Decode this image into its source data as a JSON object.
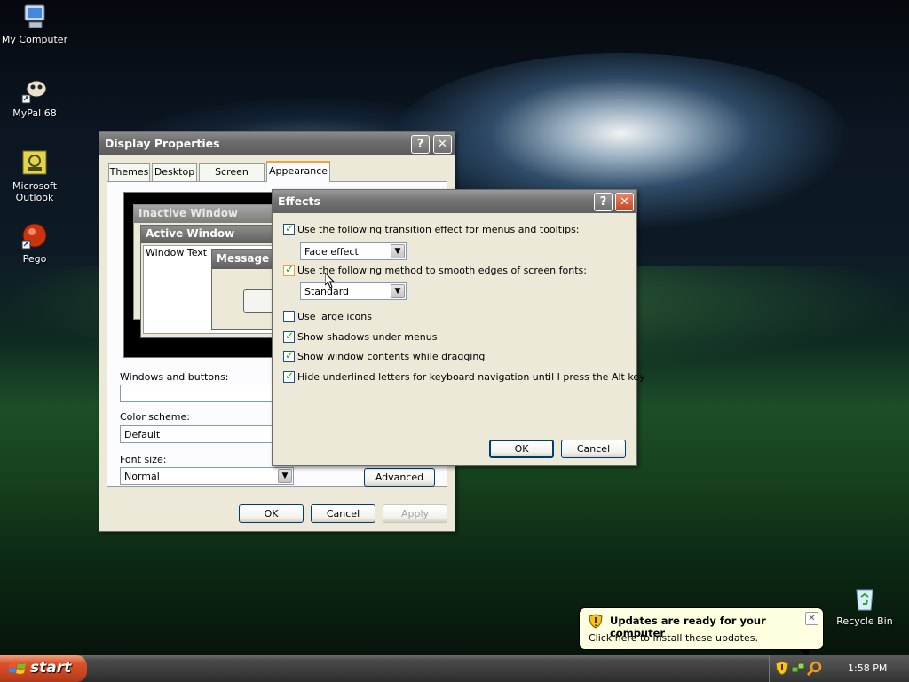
{
  "desktop": {
    "icons": [
      {
        "label": "My Computer",
        "icon": "my-computer-icon"
      },
      {
        "label": "MyPal 68",
        "icon": "mypal-icon"
      },
      {
        "label": "Microsoft Outlook",
        "icon": "outlook-icon"
      },
      {
        "label": "Pego",
        "icon": "pego-icon"
      },
      {
        "label": "Recycle Bin",
        "icon": "recycle-bin-icon"
      }
    ]
  },
  "display_properties": {
    "title": "Display Properties",
    "tabs": [
      "Themes",
      "Desktop",
      "Screen Saver",
      "Appearance"
    ],
    "active_tab": "Appearance",
    "preview": {
      "inactive_window": "Inactive Window",
      "active_window": "Active Window",
      "window_text": "Window Text",
      "message_box": "Message B"
    },
    "windows_and_buttons_label": "Windows and buttons:",
    "windows_and_buttons_value": "",
    "color_scheme_label": "Color scheme:",
    "color_scheme_value": "Default",
    "font_size_label": "Font size:",
    "font_size_value": "Normal",
    "advanced_label": "Advanced",
    "ok_label": "OK",
    "cancel_label": "Cancel",
    "apply_label": "Apply"
  },
  "effects": {
    "title": "Effects",
    "options": [
      {
        "label": "Use the following transition effect for menus and tooltips:",
        "checked": true
      },
      {
        "label": "Use the following method to smooth edges of screen fonts:",
        "checked": true
      },
      {
        "label": "Use large icons",
        "checked": false
      },
      {
        "label": "Show shadows under menus",
        "checked": true
      },
      {
        "label": "Show window contents while dragging",
        "checked": true
      },
      {
        "label": "Hide underlined letters for keyboard navigation until I press the Alt key",
        "checked": true
      }
    ],
    "transition_value": "Fade effect",
    "smoothing_value": "Standard",
    "ok_label": "OK",
    "cancel_label": "Cancel"
  },
  "balloon": {
    "title": "Updates are ready for your computer",
    "body": "Click here to install these updates."
  },
  "taskbar": {
    "start_label": "start",
    "clock": "1:58 PM"
  }
}
